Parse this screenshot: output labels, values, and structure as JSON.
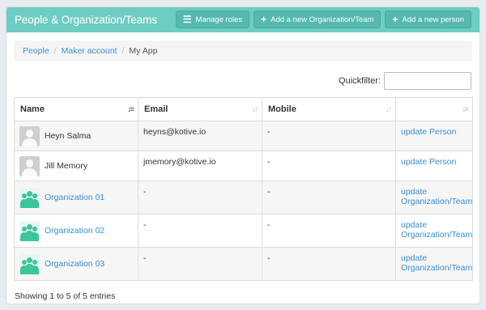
{
  "header": {
    "title": "People & Organization/Teams",
    "buttons": {
      "manage_roles": "Manage roles",
      "add_org": "Add a new Organization/Team",
      "add_person": "Add a new person"
    }
  },
  "breadcrumb": {
    "people": "People",
    "maker": "Maker account",
    "current": "My App"
  },
  "quickfilter": {
    "label": "Quickfilter:",
    "value": ""
  },
  "table": {
    "headers": {
      "name": "Name",
      "email": "Email",
      "mobile": "Mobile"
    },
    "rows": [
      {
        "name": "Heyn Salma",
        "email": "heyns@kotive.io",
        "mobile": "-",
        "action": "update Person"
      },
      {
        "name": "Jill Memory",
        "email": "jmemory@kotive.io",
        "mobile": "-",
        "action": "update Person"
      },
      {
        "name": "Organization 01",
        "email": "-",
        "mobile": "-",
        "action_line1": "update",
        "action_line2": "Organization/Team"
      },
      {
        "name": "Organization 02",
        "email": "-",
        "mobile": "-",
        "action_line1": "update",
        "action_line2": "Organization/Team"
      },
      {
        "name": "Organization 03",
        "email": "-",
        "mobile": "-",
        "action_line1": "update",
        "action_line2": "Organization/Team"
      }
    ]
  },
  "footer": {
    "info": "Showing 1 to 5 of 5 entries"
  },
  "colors": {
    "header_bg": "#6ecdc2",
    "link": "#3a8ed0",
    "org_icon": "#3cc59a"
  }
}
